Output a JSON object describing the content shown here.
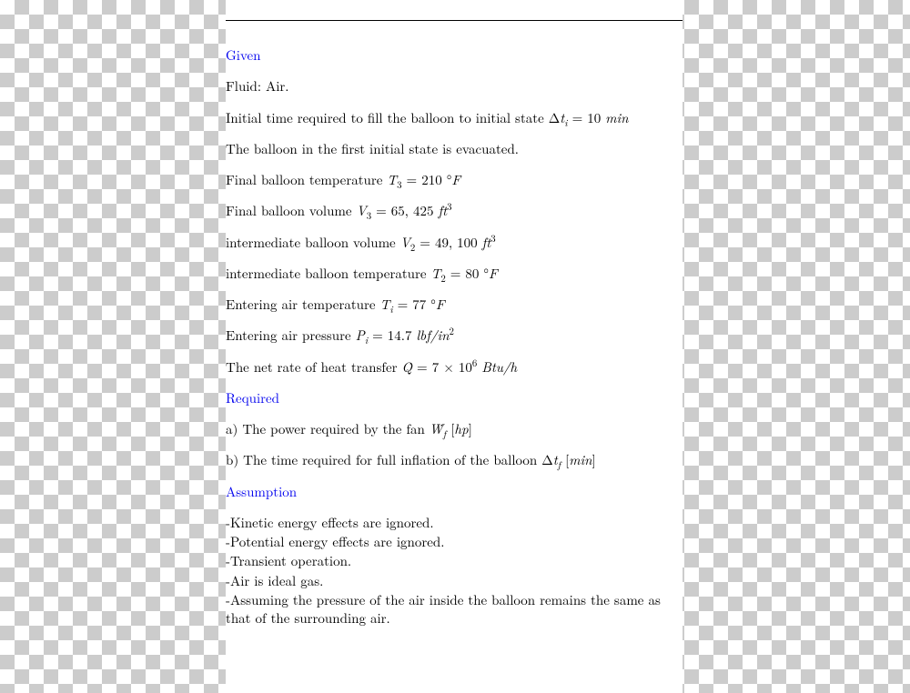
{
  "headings": {
    "given": "Given",
    "required": "Required",
    "assumption": "Assumption"
  },
  "given": {
    "fluid_label": "Fluid:  Air.",
    "dti_pre": "Initial time required to fill the balloon to initial state Δ",
    "dti_sym": "t",
    "dti_sub": "i",
    "dti_eq": " = 10 ",
    "dti_unit": "min",
    "evacuated": "The balloon in the first initial state is evacuated.",
    "t3_pre": "Final balloon temperature ",
    "t3_sym": "T",
    "t3_sub": "3",
    "t3_eq": " = 210 °",
    "t3_unit": "F",
    "v3_pre": "Final balloon volume ",
    "v3_sym": "V",
    "v3_sub": "3",
    "v3_eq": " = 65, 425 ",
    "v3_unit": "ft",
    "v3_exp": "3",
    "v2_pre": "intermediate balloon volume ",
    "v2_sym": "V",
    "v2_sub": "2",
    "v2_eq": " = 49, 100 ",
    "v2_unit": "ft",
    "v2_exp": "3",
    "t2_pre": "intermediate balloon temperature ",
    "t2_sym": "T",
    "t2_sub": "2",
    "t2_eq": " = 80 °",
    "t2_unit": "F",
    "ti_pre": "Entering air temperature ",
    "ti_sym": "T",
    "ti_sub": "i",
    "ti_eq": " = 77 °",
    "ti_unit": "F",
    "pi_pre": "Entering air pressure ",
    "pi_sym": "P",
    "pi_sub": "i",
    "pi_eq": " =  14.7 ",
    "pi_unit": "lbf/in",
    "pi_exp": "2",
    "q_pre": "The net rate of heat transfer ",
    "q_sym": "Q̇",
    "q_eq": " = 7 × 10",
    "q_exp": "6",
    "q_sp": " ",
    "q_unit": "Btu/h"
  },
  "required": {
    "a_pre": "a) The power required by the fan ",
    "a_sym": "Ẇ",
    "a_sub": "f",
    "a_sp": " [",
    "a_unit": "hp",
    "a_close": "]",
    "b_pre": "b) The time required for full inflation of the balloon Δ",
    "b_sym": "t",
    "b_sub": "f",
    "b_sp": " [",
    "b_unit": "min",
    "b_close": "]"
  },
  "assumption": {
    "a1": "-Kinetic energy effects are ignored.",
    "a2": "-Potential energy effects are ignored.",
    "a3": "-Transient operation.",
    "a4": "-Air is ideal gas.",
    "a5": "-Assuming the pressure of the air inside the balloon remains the same as that of the surrounding air."
  }
}
